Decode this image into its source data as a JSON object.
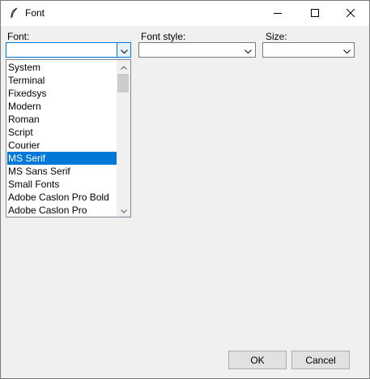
{
  "window": {
    "title": "Font"
  },
  "labels": {
    "font": "Font:",
    "font_style": "Font style:",
    "size": "Size:"
  },
  "font_combo": {
    "value": ""
  },
  "style_combo": {
    "value": ""
  },
  "size_combo": {
    "value": ""
  },
  "font_list": {
    "items": [
      "System",
      "Terminal",
      "Fixedsys",
      "Modern",
      "Roman",
      "Script",
      "Courier",
      "MS Serif",
      "MS Sans Serif",
      "Small Fonts",
      "Adobe Caslon Pro Bold",
      "Adobe Caslon Pro"
    ],
    "selected": "MS Serif"
  },
  "buttons": {
    "ok": "OK",
    "cancel": "Cancel"
  },
  "colors": {
    "selection": "#0078d7",
    "focus_border": "#0078d7",
    "dialog_bg": "#f0f0f0"
  },
  "icons": [
    "feather-icon",
    "minimize-icon",
    "maximize-icon",
    "close-icon",
    "chevron-down-icon",
    "scroll-up-icon",
    "scroll-down-icon"
  ]
}
